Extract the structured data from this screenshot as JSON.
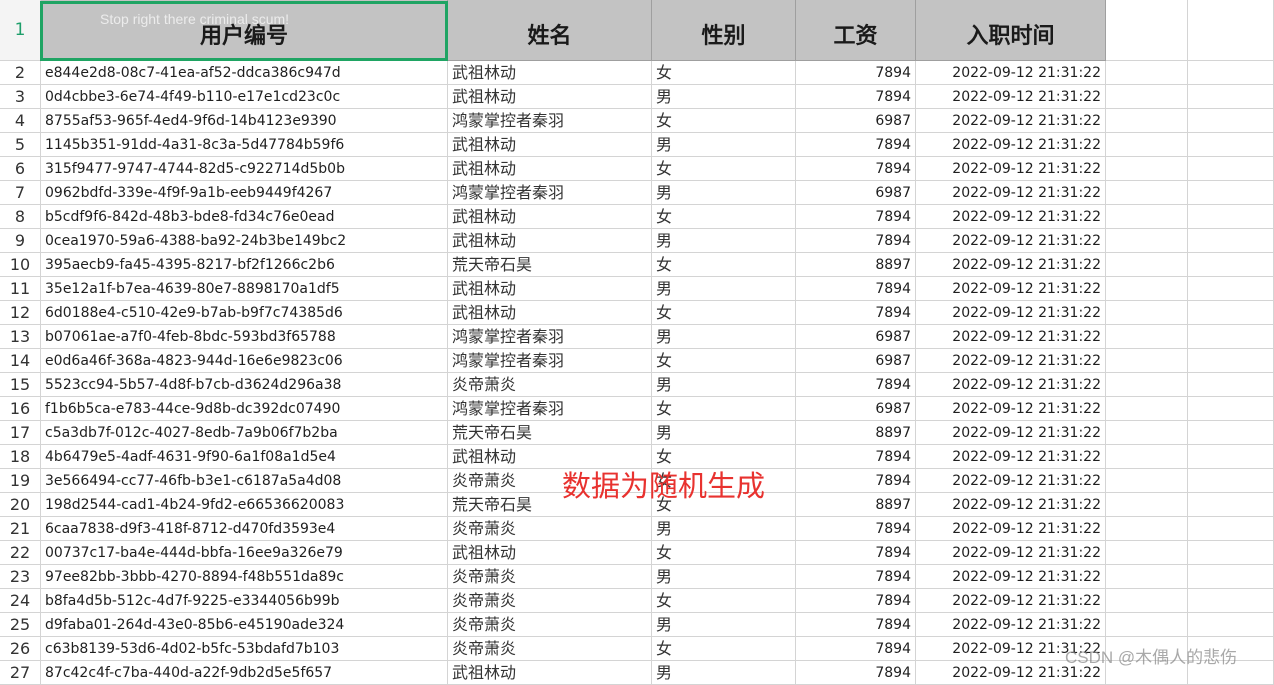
{
  "sheet": {
    "header_row_number": "1",
    "faded_header_text": "Stop right there criminal scum!",
    "columns": [
      "用户编号",
      "姓名",
      "性别",
      "工资",
      "入职时间"
    ],
    "rows": [
      {
        "n": "2",
        "id": "e844e2d8-08c7-41ea-af52-ddca386c947d",
        "name": "武祖林动",
        "gender": "女",
        "salary": "7894",
        "hired": "2022-09-12 21:31:22"
      },
      {
        "n": "3",
        "id": "0d4cbbe3-6e74-4f49-b110-e17e1cd23c0c",
        "name": "武祖林动",
        "gender": "男",
        "salary": "7894",
        "hired": "2022-09-12 21:31:22"
      },
      {
        "n": "4",
        "id": "8755af53-965f-4ed4-9f6d-14b4123e9390",
        "name": "鸿蒙掌控者秦羽",
        "gender": "女",
        "salary": "6987",
        "hired": "2022-09-12 21:31:22"
      },
      {
        "n": "5",
        "id": "1145b351-91dd-4a31-8c3a-5d47784b59f6",
        "name": "武祖林动",
        "gender": "男",
        "salary": "7894",
        "hired": "2022-09-12 21:31:22"
      },
      {
        "n": "6",
        "id": "315f9477-9747-4744-82d5-c922714d5b0b",
        "name": "武祖林动",
        "gender": "女",
        "salary": "7894",
        "hired": "2022-09-12 21:31:22"
      },
      {
        "n": "7",
        "id": "0962bdfd-339e-4f9f-9a1b-eeb9449f4267",
        "name": "鸿蒙掌控者秦羽",
        "gender": "男",
        "salary": "6987",
        "hired": "2022-09-12 21:31:22"
      },
      {
        "n": "8",
        "id": "b5cdf9f6-842d-48b3-bde8-fd34c76e0ead",
        "name": "武祖林动",
        "gender": "女",
        "salary": "7894",
        "hired": "2022-09-12 21:31:22"
      },
      {
        "n": "9",
        "id": "0cea1970-59a6-4388-ba92-24b3be149bc2",
        "name": "武祖林动",
        "gender": "男",
        "salary": "7894",
        "hired": "2022-09-12 21:31:22"
      },
      {
        "n": "10",
        "id": "395aecb9-fa45-4395-8217-bf2f1266c2b6",
        "name": "荒天帝石昊",
        "gender": "女",
        "salary": "8897",
        "hired": "2022-09-12 21:31:22"
      },
      {
        "n": "11",
        "id": "35e12a1f-b7ea-4639-80e7-8898170a1df5",
        "name": "武祖林动",
        "gender": "男",
        "salary": "7894",
        "hired": "2022-09-12 21:31:22"
      },
      {
        "n": "12",
        "id": "6d0188e4-c510-42e9-b7ab-b9f7c74385d6",
        "name": "武祖林动",
        "gender": "女",
        "salary": "7894",
        "hired": "2022-09-12 21:31:22"
      },
      {
        "n": "13",
        "id": "b07061ae-a7f0-4feb-8bdc-593bd3f65788",
        "name": "鸿蒙掌控者秦羽",
        "gender": "男",
        "salary": "6987",
        "hired": "2022-09-12 21:31:22"
      },
      {
        "n": "14",
        "id": "e0d6a46f-368a-4823-944d-16e6e9823c06",
        "name": "鸿蒙掌控者秦羽",
        "gender": "女",
        "salary": "6987",
        "hired": "2022-09-12 21:31:22"
      },
      {
        "n": "15",
        "id": "5523cc94-5b57-4d8f-b7cb-d3624d296a38",
        "name": "炎帝萧炎",
        "gender": "男",
        "salary": "7894",
        "hired": "2022-09-12 21:31:22"
      },
      {
        "n": "16",
        "id": "f1b6b5ca-e783-44ce-9d8b-dc392dc07490",
        "name": "鸿蒙掌控者秦羽",
        "gender": "女",
        "salary": "6987",
        "hired": "2022-09-12 21:31:22"
      },
      {
        "n": "17",
        "id": "c5a3db7f-012c-4027-8edb-7a9b06f7b2ba",
        "name": "荒天帝石昊",
        "gender": "男",
        "salary": "8897",
        "hired": "2022-09-12 21:31:22"
      },
      {
        "n": "18",
        "id": "4b6479e5-4adf-4631-9f90-6a1f08a1d5e4",
        "name": "武祖林动",
        "gender": "女",
        "salary": "7894",
        "hired": "2022-09-12 21:31:22"
      },
      {
        "n": "19",
        "id": "3e566494-cc77-46fb-b3e1-c6187a5a4d08",
        "name": "炎帝萧炎",
        "gender": "女",
        "salary": "7894",
        "hired": "2022-09-12 21:31:22"
      },
      {
        "n": "20",
        "id": "198d2544-cad1-4b24-9fd2-e66536620083",
        "name": "荒天帝石昊",
        "gender": "女",
        "salary": "8897",
        "hired": "2022-09-12 21:31:22"
      },
      {
        "n": "21",
        "id": "6caa7838-d9f3-418f-8712-d470fd3593e4",
        "name": "炎帝萧炎",
        "gender": "男",
        "salary": "7894",
        "hired": "2022-09-12 21:31:22"
      },
      {
        "n": "22",
        "id": "00737c17-ba4e-444d-bbfa-16ee9a326e79",
        "name": "武祖林动",
        "gender": "女",
        "salary": "7894",
        "hired": "2022-09-12 21:31:22"
      },
      {
        "n": "23",
        "id": "97ee82bb-3bbb-4270-8894-f48b551da89c",
        "name": "炎帝萧炎",
        "gender": "男",
        "salary": "7894",
        "hired": "2022-09-12 21:31:22"
      },
      {
        "n": "24",
        "id": "b8fa4d5b-512c-4d7f-9225-e3344056b99b",
        "name": "炎帝萧炎",
        "gender": "女",
        "salary": "7894",
        "hired": "2022-09-12 21:31:22"
      },
      {
        "n": "25",
        "id": "d9faba01-264d-43e0-85b6-e45190ade324",
        "name": "炎帝萧炎",
        "gender": "男",
        "salary": "7894",
        "hired": "2022-09-12 21:31:22"
      },
      {
        "n": "26",
        "id": "c63b8139-53d6-4d02-b5fc-53bdafd7b103",
        "name": "炎帝萧炎",
        "gender": "女",
        "salary": "7894",
        "hired": "2022-09-12 21:31:22"
      },
      {
        "n": "27",
        "id": "87c42c4f-c7ba-440d-a22f-9db2d5e5f657",
        "name": "武祖林动",
        "gender": "男",
        "salary": "7894",
        "hired": "2022-09-12 21:31:22"
      }
    ]
  },
  "overlay_note": "数据为随机生成",
  "watermark": "CSDN @木偶人的悲伤",
  "colors": {
    "selection_border": "#1fa463",
    "header_fill": "#c3c3c3",
    "overlay_note": "#e8322f"
  }
}
